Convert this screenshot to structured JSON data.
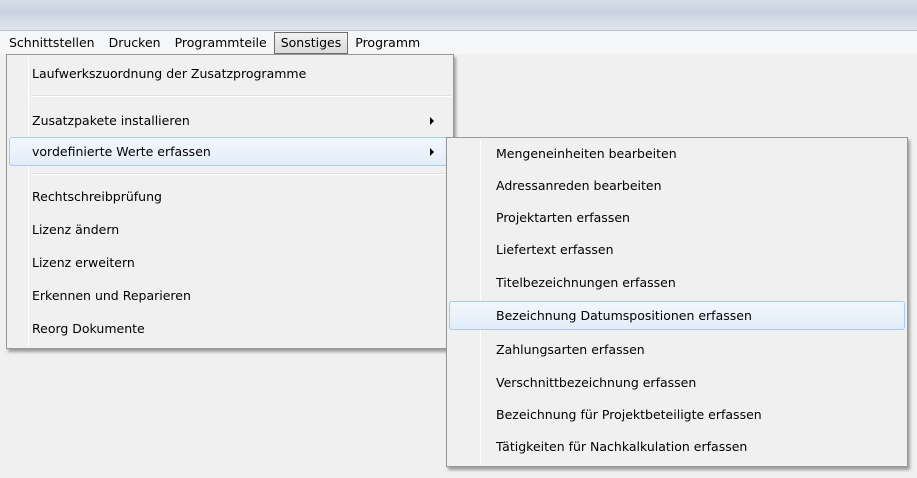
{
  "menubar": {
    "items": [
      "Schnittstellen",
      "Drucken",
      "Programmteile",
      "Sonstiges",
      "Programm"
    ],
    "active": "Sonstiges"
  },
  "sonstiges_menu": {
    "items": [
      {
        "label": "Laufwerkszuordnung der Zusatzprogramme"
      },
      {
        "label": "Zusatzpakete installieren",
        "submenu": true
      },
      {
        "label": "vordefinierte Werte erfassen",
        "submenu": true,
        "highlighted": true
      },
      {
        "label": "Rechtschreibprüfung"
      },
      {
        "label": "Lizenz ändern"
      },
      {
        "label": "Lizenz erweitern"
      },
      {
        "label": "Erkennen und Reparieren"
      },
      {
        "label": "Reorg Dokumente"
      }
    ]
  },
  "werte_submenu": {
    "items": [
      {
        "label": "Mengeneinheiten bearbeiten"
      },
      {
        "label": "Adressanreden bearbeiten"
      },
      {
        "label": "Projektarten erfassen"
      },
      {
        "label": "Liefertext erfassen"
      },
      {
        "label": "Titelbezeichnungen erfassen"
      },
      {
        "label": "Bezeichnung Datumspositionen erfassen",
        "highlighted": true
      },
      {
        "label": "Zahlungsarten erfassen"
      },
      {
        "label": "Verschnittbezeichnung erfassen"
      },
      {
        "label": "Bezeichnung für Projektbeteiligte erfassen"
      },
      {
        "label": "Tätigkeiten für Nachkalkulation erfassen"
      }
    ]
  }
}
